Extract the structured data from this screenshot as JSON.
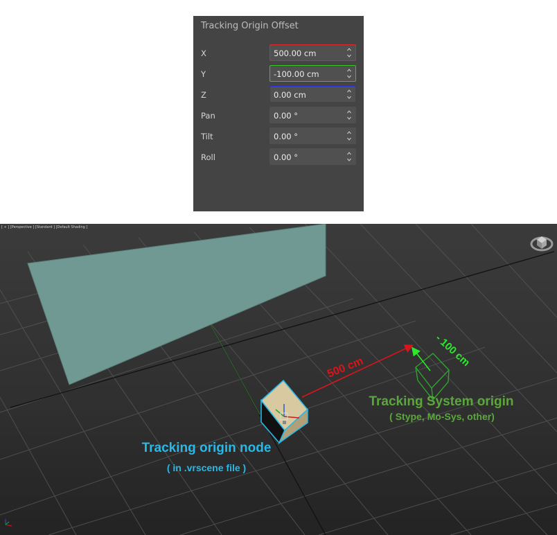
{
  "panel": {
    "title": "Tracking Origin Offset",
    "rows": [
      {
        "label": "X",
        "value": "500.00 cm",
        "border": "#e0262b"
      },
      {
        "label": "Y",
        "value": "-100.00 cm",
        "border": "#39c426"
      },
      {
        "label": "Z",
        "value": "0.00 cm",
        "border": "#2b34d6"
      },
      {
        "label": "Pan",
        "value": "0.00 °",
        "border": ""
      },
      {
        "label": "Tilt",
        "value": "0.00 °",
        "border": ""
      },
      {
        "label": "Roll",
        "value": "0.00 °",
        "border": ""
      }
    ]
  },
  "viewport": {
    "header": "[ + ] [Perspective ] [Standard ] [Default Shading ]",
    "labels": {
      "x_offset": "500 cm",
      "y_offset": "- 100 cm",
      "system_origin_title": "Tracking System origin",
      "system_origin_subtitle": "( Stype, Mo-Sys, other)",
      "node_title": "Tracking origin node",
      "node_subtitle": "( in .vrscene file )"
    },
    "colors": {
      "x_axis": "#d8151a",
      "y_axis": "#2ee82e",
      "system_origin": "#5aa83b",
      "node": "#2ab8e6",
      "wall": "#6f9992",
      "cube": "#c7b48c"
    },
    "icons": [
      "viewcube-icon",
      "axis-tripod-icon",
      "move-gizmo-icon"
    ]
  }
}
